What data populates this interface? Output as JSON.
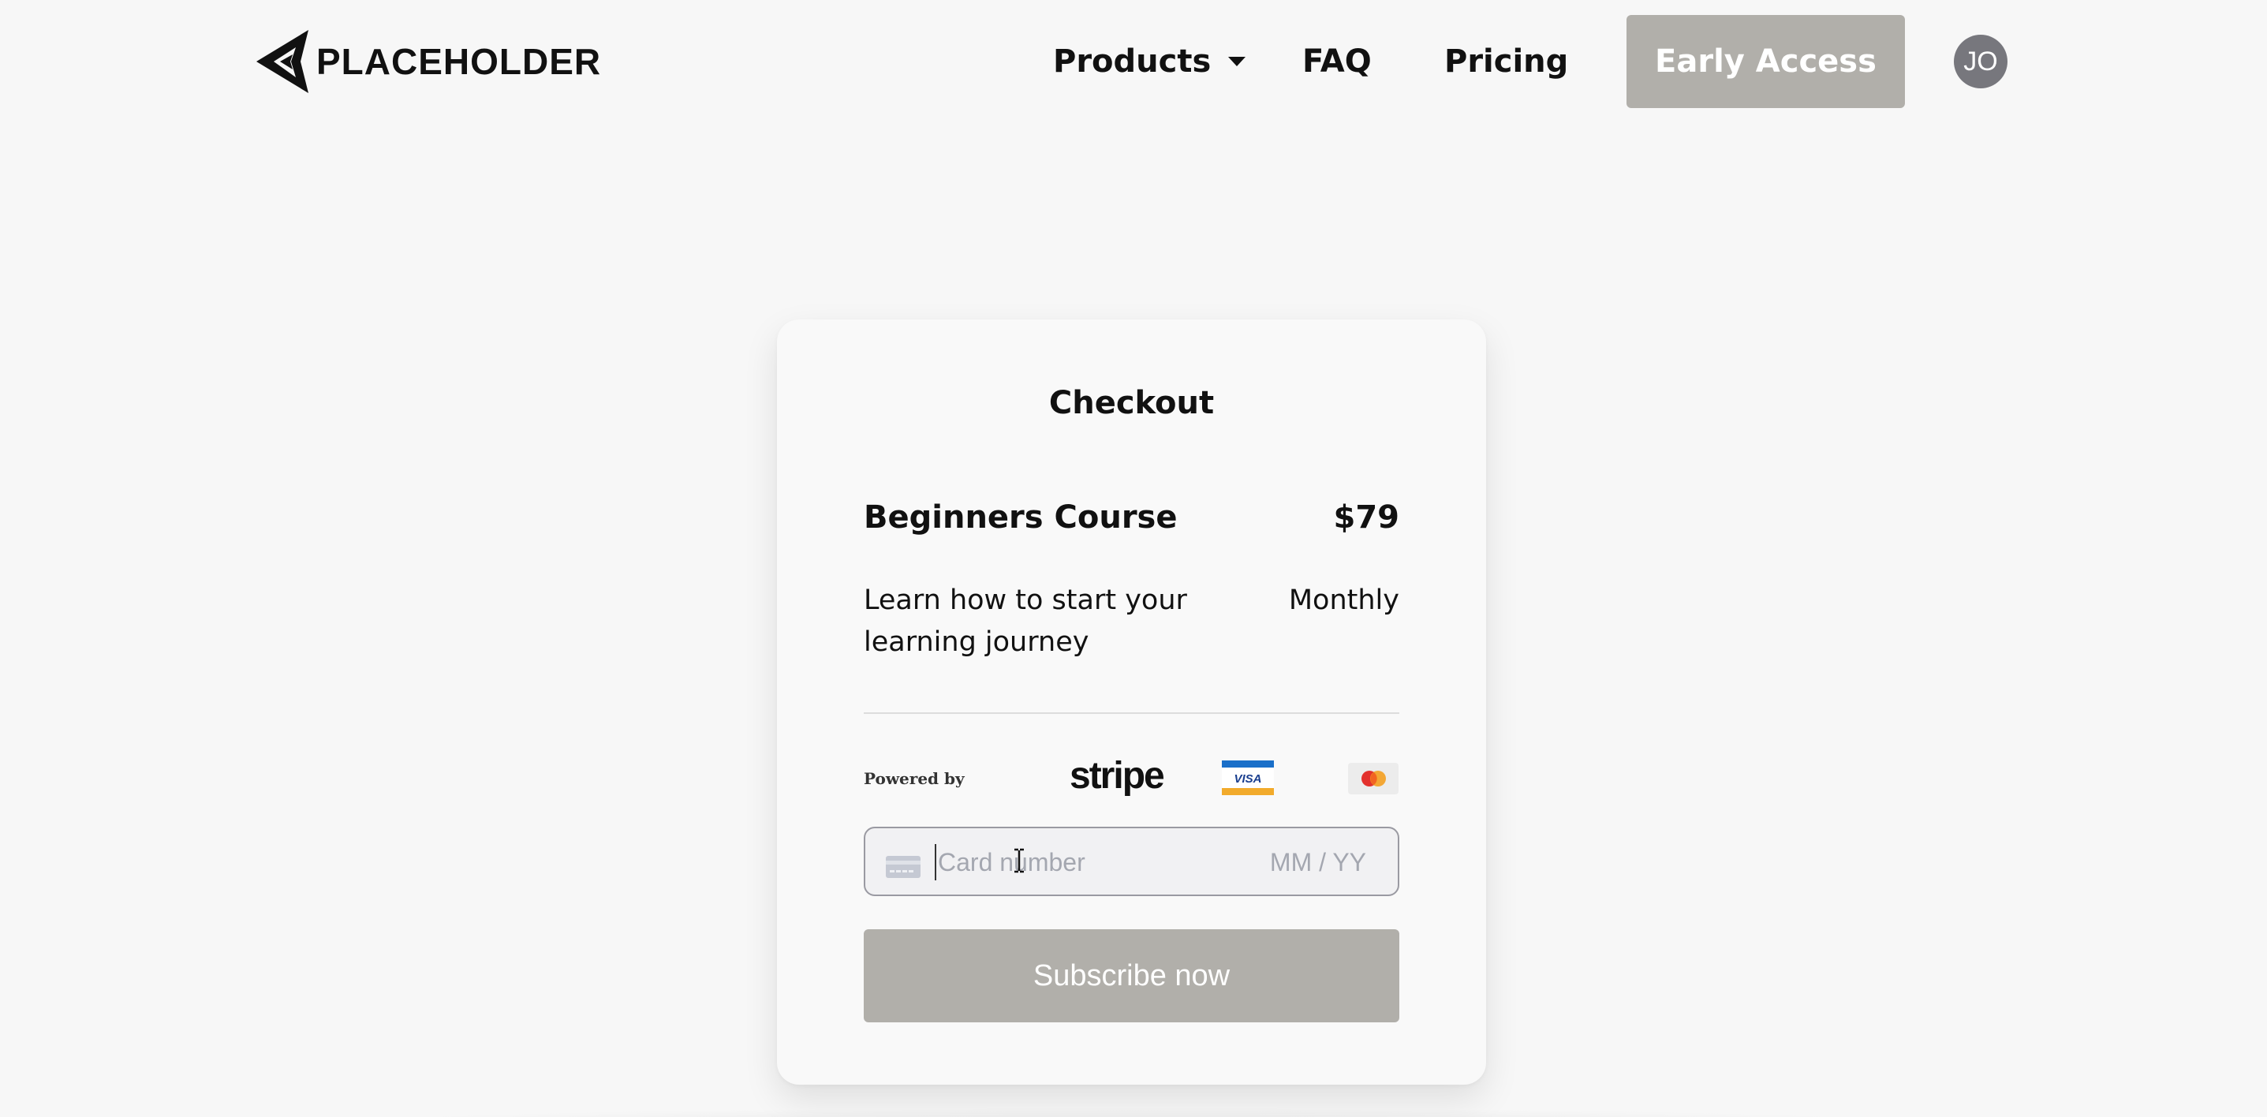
{
  "header": {
    "logo_text": "PLACEHOLDER",
    "nav": {
      "products": "Products",
      "faq": "FAQ",
      "pricing": "Pricing"
    },
    "cta_label": "Early Access",
    "avatar_initials": "JO"
  },
  "checkout": {
    "title": "Checkout",
    "product": {
      "name": "Beginners Course",
      "price": "$79",
      "description": "Learn how to start your learning journey",
      "period": "Monthly"
    },
    "payment": {
      "powered_by": "Powered by",
      "provider_logo": "stripe",
      "visa_text": "VISA",
      "card_number_placeholder": "Card number",
      "expiry_placeholder": "MM / YY",
      "submit_label": "Subscribe now"
    }
  },
  "colors": {
    "button_bg": "#b1afaa",
    "avatar_bg": "#77777d",
    "page_bg": "#f7f7f7",
    "field_border": "#9a9aa2"
  },
  "icons": [
    "logo-icon",
    "chevron-down-icon",
    "visa-icon",
    "mastercard-icon",
    "credit-card-icon",
    "text-cursor-icon"
  ]
}
